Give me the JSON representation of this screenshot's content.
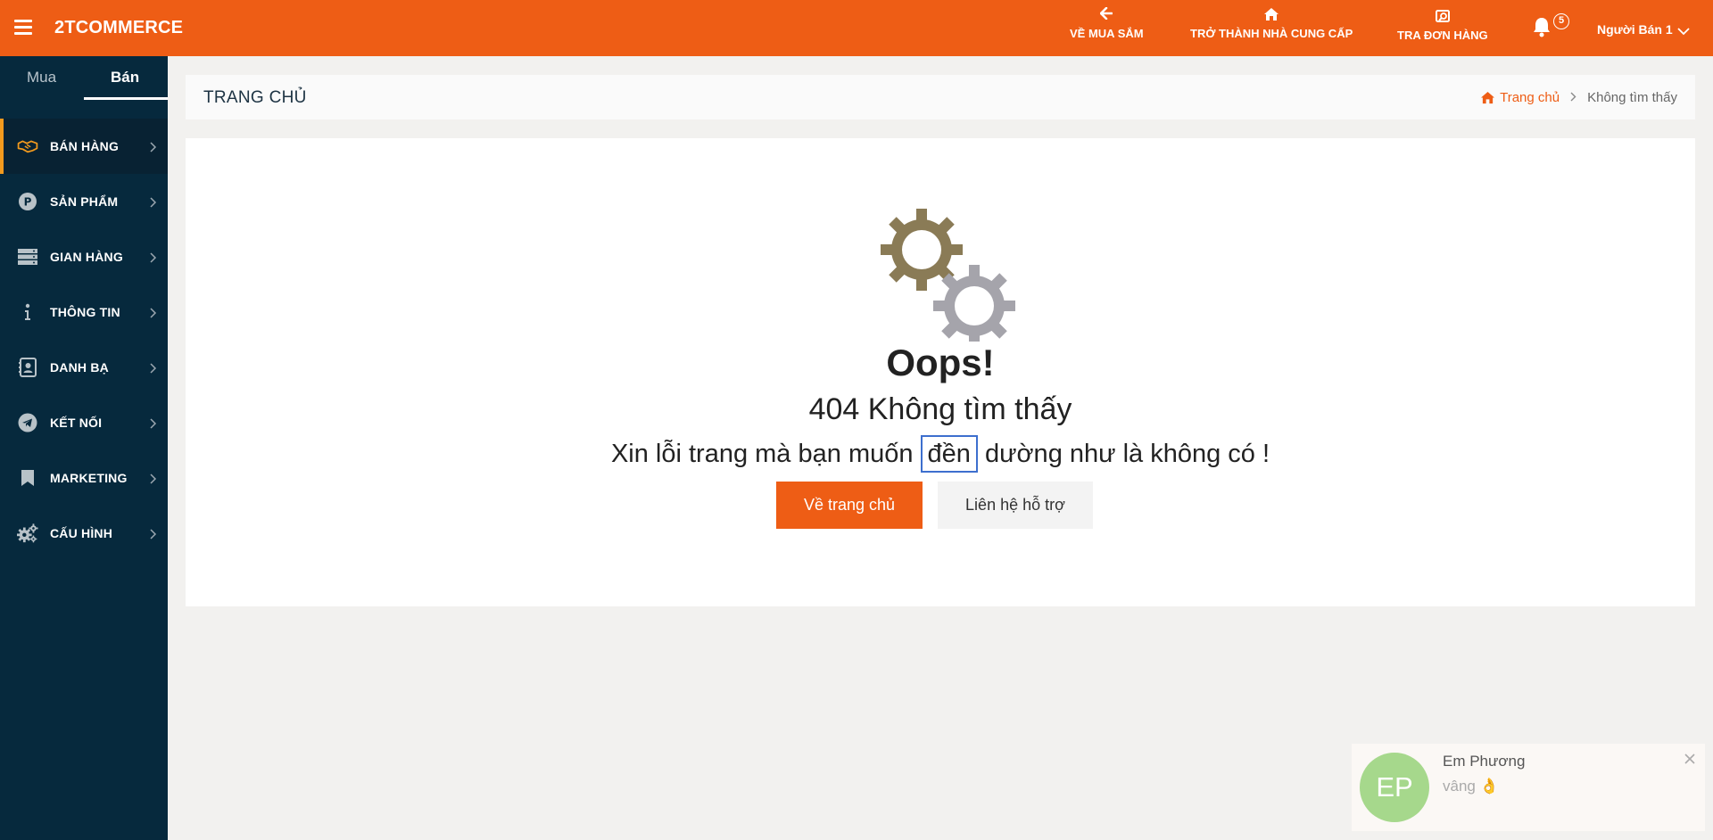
{
  "header": {
    "brand": "2TCOMMERCE",
    "nav": [
      {
        "label": "VỀ MUA SẮM",
        "icon": "arrow-left-icon"
      },
      {
        "label": "TRỞ THÀNH NHÀ CUNG CẤP",
        "icon": "home-icon"
      },
      {
        "label": "TRA ĐƠN HÀNG",
        "icon": "search-order-icon"
      }
    ],
    "notification_count": "5",
    "user_name": "Người Bán 1"
  },
  "sidebar": {
    "tabs": [
      {
        "label": "Mua",
        "active": false
      },
      {
        "label": "Bán",
        "active": true
      }
    ],
    "items": [
      {
        "label": "BÁN HÀNG",
        "icon": "handshake-icon",
        "active": true
      },
      {
        "label": "SẢN PHẨM",
        "icon": "product-icon",
        "active": false
      },
      {
        "label": "GIAN HÀNG",
        "icon": "store-icon",
        "active": false
      },
      {
        "label": "THÔNG TIN",
        "icon": "info-icon",
        "active": false
      },
      {
        "label": "DANH BẠ",
        "icon": "contacts-icon",
        "active": false
      },
      {
        "label": "KẾT NỐI",
        "icon": "telegram-icon",
        "active": false
      },
      {
        "label": "MARKETING",
        "icon": "bookmark-icon",
        "active": false
      },
      {
        "label": "CẤU HÌNH",
        "icon": "gears-icon",
        "active": false
      }
    ]
  },
  "page": {
    "title": "TRANG CHỦ",
    "breadcrumb": {
      "home": "Trang chủ",
      "current": "Không tìm thấy"
    }
  },
  "error": {
    "oops": "Oops!",
    "title": "404 Không tìm thấy",
    "message_before": "Xin lỗi trang mà bạn muốn",
    "message_highlight": "đền",
    "message_after": "dường như là không có !",
    "home_button": "Về trang chủ",
    "support_button": "Liên hệ hỗ trợ"
  },
  "chat": {
    "initials": "EP",
    "name": "Em Phương",
    "message": "vâng 👌"
  },
  "colors": {
    "topbar": "#ee5d15",
    "sidebar": "#06293d",
    "active_accent": "#f29a1e",
    "avatar": "#a6d88c",
    "highlight_border": "#3d6fce"
  }
}
